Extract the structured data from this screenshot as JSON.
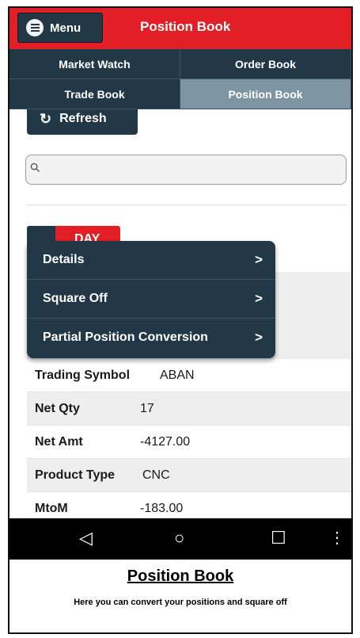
{
  "header": {
    "menu_label": "Menu",
    "title": "Position Book"
  },
  "tabs": [
    {
      "label": "Market Watch",
      "active": false
    },
    {
      "label": "Order Book",
      "active": false
    },
    {
      "label": "Trade Book",
      "active": false
    },
    {
      "label": "Position Book",
      "active": true
    }
  ],
  "toolbar": {
    "refresh_label": "Refresh"
  },
  "search": {
    "placeholder": ""
  },
  "filter": {
    "day_label": "DAY"
  },
  "popup_menu": {
    "items": [
      {
        "label": "Details",
        "arrow": ">"
      },
      {
        "label": "Square Off",
        "arrow": ">"
      },
      {
        "label": "Partial Position Conversion",
        "arrow": ">"
      }
    ]
  },
  "position": {
    "rows": [
      {
        "key": "Trading Symbol",
        "value": "ABAN"
      },
      {
        "key": "Net Qty",
        "value": "17"
      },
      {
        "key": "Net Amt",
        "value": "-4127.00"
      },
      {
        "key": "Product Type",
        "value": "CNC"
      },
      {
        "key": "MtoM",
        "value": "-183.00"
      }
    ]
  },
  "navbar": {
    "icons": [
      "back-icon",
      "home-icon",
      "recents-icon",
      "more-icon"
    ],
    "back_glyph": "◁",
    "home_glyph": "○",
    "recents_glyph": "☐",
    "more_glyph": "⋮"
  },
  "caption": {
    "title": "Position Book",
    "text": "Here you can convert your positions and square off"
  },
  "colors": {
    "brand_red": "#e21e26",
    "dark_navy": "#233846",
    "active_tab": "#7d94a3"
  }
}
